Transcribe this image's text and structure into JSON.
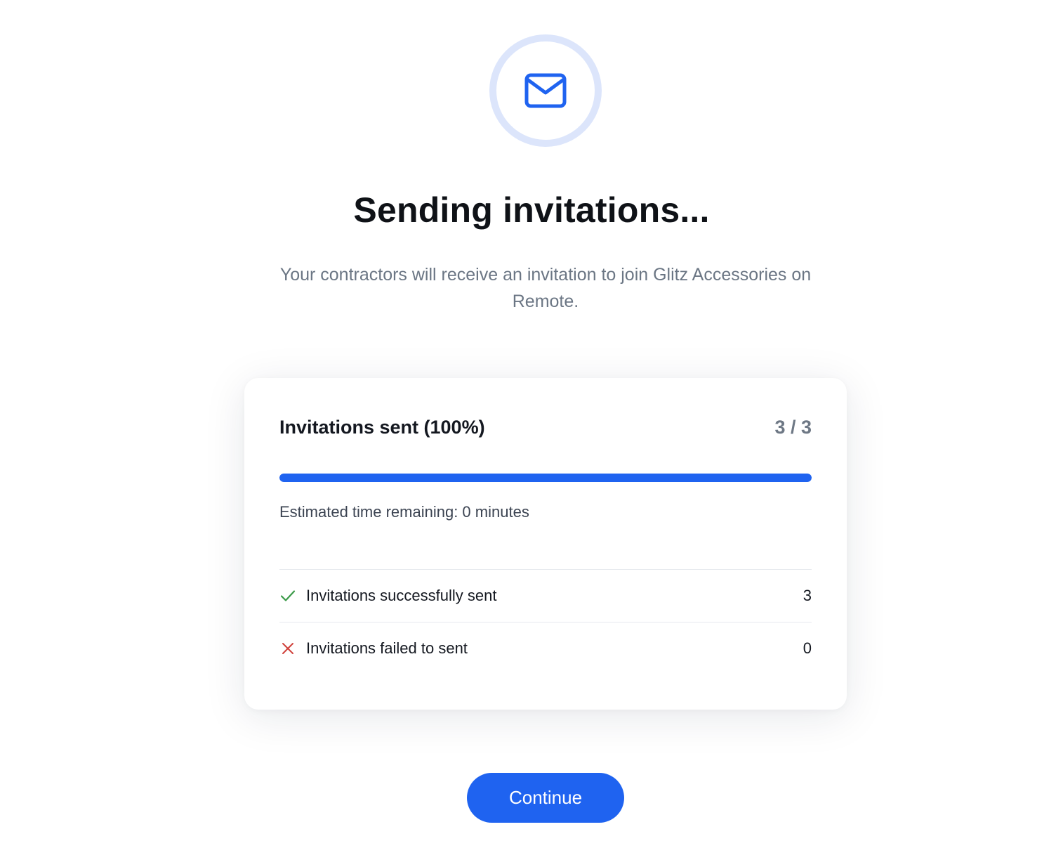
{
  "header": {
    "icon": "envelope-icon",
    "title": "Sending invitations...",
    "subtitle": "Your contractors will receive an invitation to join Glitz Accessories on Remote."
  },
  "card": {
    "title": "Invitations sent (100%)",
    "count": "3 / 3",
    "progress": 1.0,
    "eta": "Estimated time remaining: 0 minutes",
    "rows": [
      {
        "icon": "check-icon",
        "label": "Invitations successfully sent",
        "value": "3"
      },
      {
        "icon": "close-icon",
        "label": "Invitations failed to sent",
        "value": "0"
      }
    ]
  },
  "actions": {
    "continue_label": "Continue"
  },
  "colors": {
    "accent": "#1f63f0",
    "ring": "#dce5fb",
    "success": "#3a9a48",
    "error": "#d0413b"
  }
}
